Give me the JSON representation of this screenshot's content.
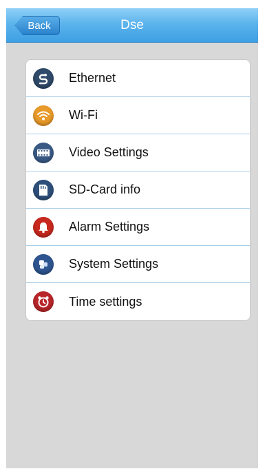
{
  "header": {
    "back_label": "Back",
    "title": "Dse"
  },
  "menu": {
    "items": [
      {
        "label": "Ethernet",
        "icon": "ethernet-icon",
        "color": "#2f4a6a"
      },
      {
        "label": "Wi-Fi",
        "icon": "wifi-icon",
        "color": "#e89a2a"
      },
      {
        "label": "Video Settings",
        "icon": "video-icon",
        "color": "#3a5a86"
      },
      {
        "label": "SD-Card info",
        "icon": "sd-card-icon",
        "color": "#2d4f7a"
      },
      {
        "label": "Alarm Settings",
        "icon": "alarm-bell-icon",
        "color": "#c8281e"
      },
      {
        "label": "System Settings",
        "icon": "system-icon",
        "color": "#2e5590"
      },
      {
        "label": "Time settings",
        "icon": "clock-icon",
        "color": "#b8262a"
      }
    ]
  },
  "colors": {
    "navbar": "#5cb4ec",
    "background": "#d8d8d8",
    "divider": "#a9cfe8"
  }
}
